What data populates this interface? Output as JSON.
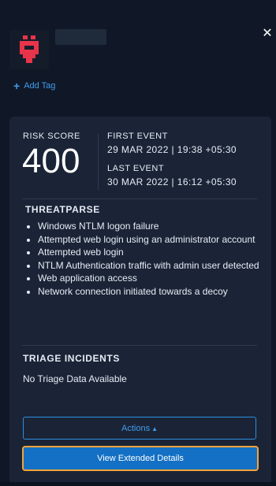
{
  "header": {
    "close_icon": "close-icon",
    "add_tag_label": "Add Tag",
    "avatar_icon": "red-skull-avatar-icon"
  },
  "summary": {
    "risk_score_label": "RISK SCORE",
    "risk_score_value": "400",
    "first_event_label": "FIRST EVENT",
    "first_event_value": "29 MAR 2022 | 19:38 +05:30",
    "last_event_label": "LAST EVENT",
    "last_event_value": "30 MAR 2022 | 16:12 +05:30"
  },
  "threatparse": {
    "title": "THREATPARSE",
    "items": [
      "Windows NTLM logon failure",
      "Attempted web login using an administrator account",
      "Attempted web login",
      "NTLM Authentication traffic with admin user detected",
      "Web application access",
      "Network connection initiated towards a decoy"
    ]
  },
  "triage": {
    "title": "TRIAGE INCIDENTS",
    "empty_text": "No Triage Data Available"
  },
  "buttons": {
    "actions_label": "Actions",
    "view_extended_label": "View Extended Details"
  },
  "colors": {
    "background": "#101827",
    "card": "#1b2436",
    "accent": "#3f9df0",
    "primary_button": "#1370c4",
    "focus_outline": "#f3a43a",
    "avatar_red": "#e8344a"
  }
}
